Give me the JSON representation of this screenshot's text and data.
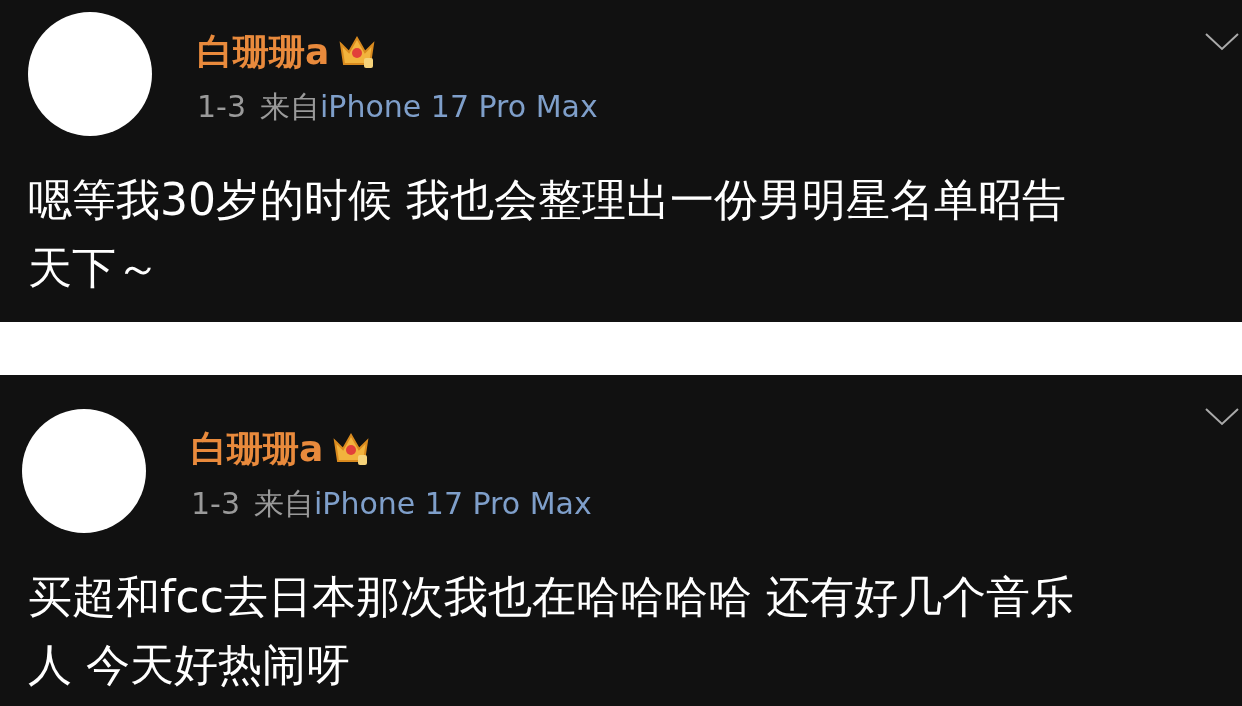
{
  "posts": [
    {
      "author": "白珊珊a",
      "time": "1-3",
      "source": "来自",
      "device": "iPhone 17 Pro Max",
      "text_lines": [
        "嗯等我30岁的时候 我也会整理出一份男明星名单昭告",
        "天下～"
      ]
    },
    {
      "author": "白珊珊a",
      "time": "1-3",
      "source": "来自",
      "device": "iPhone 17 Pro Max",
      "text_lines": [
        "买超和fcc去日本那次我也在哈哈哈哈 还有好几个音乐",
        "人 今天好热闹呀"
      ]
    }
  ]
}
